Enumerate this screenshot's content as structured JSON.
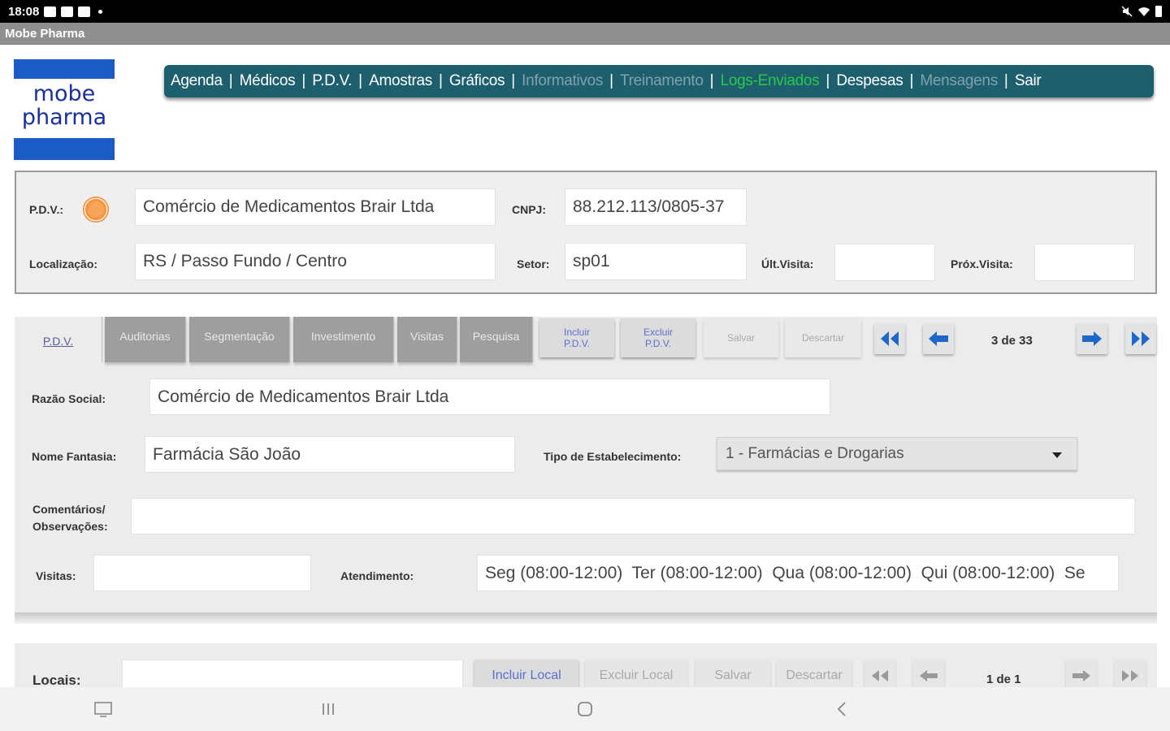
{
  "status_bar": {
    "time": "18:08",
    "icons": [
      "gallery-icon",
      "chat-icon",
      "photos-icon",
      "dot-icon",
      "mute-icon",
      "wifi-icon",
      "battery-icon"
    ]
  },
  "app": {
    "title": "Mobe Pharma"
  },
  "logo": {
    "line1": "mobe",
    "line2": "pharma"
  },
  "menu": {
    "items": [
      {
        "label": "Agenda",
        "state": "normal"
      },
      {
        "label": "Médicos",
        "state": "normal"
      },
      {
        "label": "P.D.V.",
        "state": "normal"
      },
      {
        "label": "Amostras",
        "state": "normal"
      },
      {
        "label": "Gráficos",
        "state": "normal"
      },
      {
        "label": "Informativos",
        "state": "disabled"
      },
      {
        "label": "Treinamento",
        "state": "disabled"
      },
      {
        "label": "Logs-Enviados",
        "state": "active"
      },
      {
        "label": "Despesas",
        "state": "normal"
      },
      {
        "label": "Mensagens",
        "state": "disabled"
      },
      {
        "label": "Sair",
        "state": "normal"
      }
    ],
    "separator": "|"
  },
  "header": {
    "pdv_label": "P.D.V.:",
    "pdv_value": "Comércio de Medicamentos Brair Ltda",
    "cnpj_label": "CNPJ:",
    "cnpj_value": "88.212.113/0805-37",
    "localizacao_label": "Localização:",
    "localizacao_value": "RS / Passo Fundo / Centro",
    "setor_label": "Setor:",
    "setor_value": "sp01",
    "ult_visita_label": "Últ.Visita:",
    "ult_visita_value": "",
    "prox_visita_label": "Próx.Visita:",
    "prox_visita_value": ""
  },
  "tabs": {
    "items": [
      "P.D.V.",
      "Auditorias",
      "Segmentação",
      "Investimento",
      "Visitas",
      "Pesquisa"
    ],
    "incluir_label_1": "Incluir",
    "incluir_label_2": "P.D.V.",
    "excluir_label_1": "Excluir",
    "excluir_label_2": "P.D.V.",
    "salvar": "Salvar",
    "descartar": "Descartar",
    "counter": "3 de 33"
  },
  "form": {
    "razao_social_label": "Razão Social:",
    "razao_social_value": "Comércio de Medicamentos Brair Ltda",
    "nome_fantasia_label": "Nome Fantasia:",
    "nome_fantasia_value": "Farmácia São João",
    "tipo_label": "Tipo de Estabelecimento:",
    "tipo_value": "1 - Farmácias e Drogarias",
    "comentarios_label_1": "Comentários/",
    "comentarios_label_2": "Observações:",
    "comentarios_value": "",
    "visitas_label": "Visitas:",
    "visitas_value": "",
    "atendimento_label": "Atendimento:",
    "atendimento_value": "Seg (08:00-12:00)  Ter (08:00-12:00)  Qua (08:00-12:00)  Qui (08:00-12:00)  Se"
  },
  "locais": {
    "label": "Locais:",
    "value": "",
    "incluir": "Incluir Local",
    "excluir": "Excluir Local",
    "salvar": "Salvar",
    "descartar": "Descartar",
    "counter": "1 de 1"
  },
  "colors": {
    "menu_bg": "#1e5f6e",
    "menu_active": "#27c94a",
    "menu_disabled": "#7fa3ac",
    "logo_blue": "#1a5bc4",
    "nav_arrow_blue": "#1f68c9",
    "button_blue_text": "#5b6fd0"
  }
}
